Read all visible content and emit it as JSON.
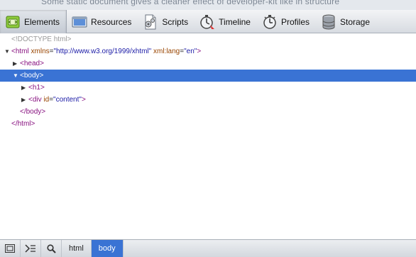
{
  "top_strip_text": "Some static document gives a cleaner effect of developer-kit like in structure",
  "toolbar": {
    "tabs": [
      {
        "label": "Elements",
        "icon": "elements-icon",
        "active": true
      },
      {
        "label": "Resources",
        "icon": "resources-icon",
        "active": false
      },
      {
        "label": "Scripts",
        "icon": "scripts-icon",
        "active": false
      },
      {
        "label": "Timeline",
        "icon": "timeline-icon",
        "active": false
      },
      {
        "label": "Profiles",
        "icon": "profiles-icon",
        "active": false
      },
      {
        "label": "Storage",
        "icon": "storage-icon",
        "active": false
      }
    ]
  },
  "dom_tree": {
    "doctype": "<!DOCTYPE html>",
    "html_open": "<html",
    "html_attr1_name": "xmlns",
    "html_attr1_val": "\"http://www.w3.org/1999/xhtml\"",
    "html_attr2_name": "xml:lang",
    "html_attr2_val": "\"en\"",
    "html_close_bracket": ">",
    "head": "<head>",
    "body": "<body>",
    "h1": "<h1>",
    "div_open": "<div",
    "div_attr_name": "id",
    "div_attr_val": "\"content\"",
    "div_close_bracket": ">",
    "body_close": "</body>",
    "html_close": "</html>"
  },
  "status_bar": {
    "breadcrumbs": [
      "html",
      "body"
    ],
    "selected_crumb": "body"
  },
  "colors": {
    "selection": "#3a73d4",
    "tag": "#881280",
    "attr_name": "#994500",
    "attr_value": "#1a1aa6"
  }
}
